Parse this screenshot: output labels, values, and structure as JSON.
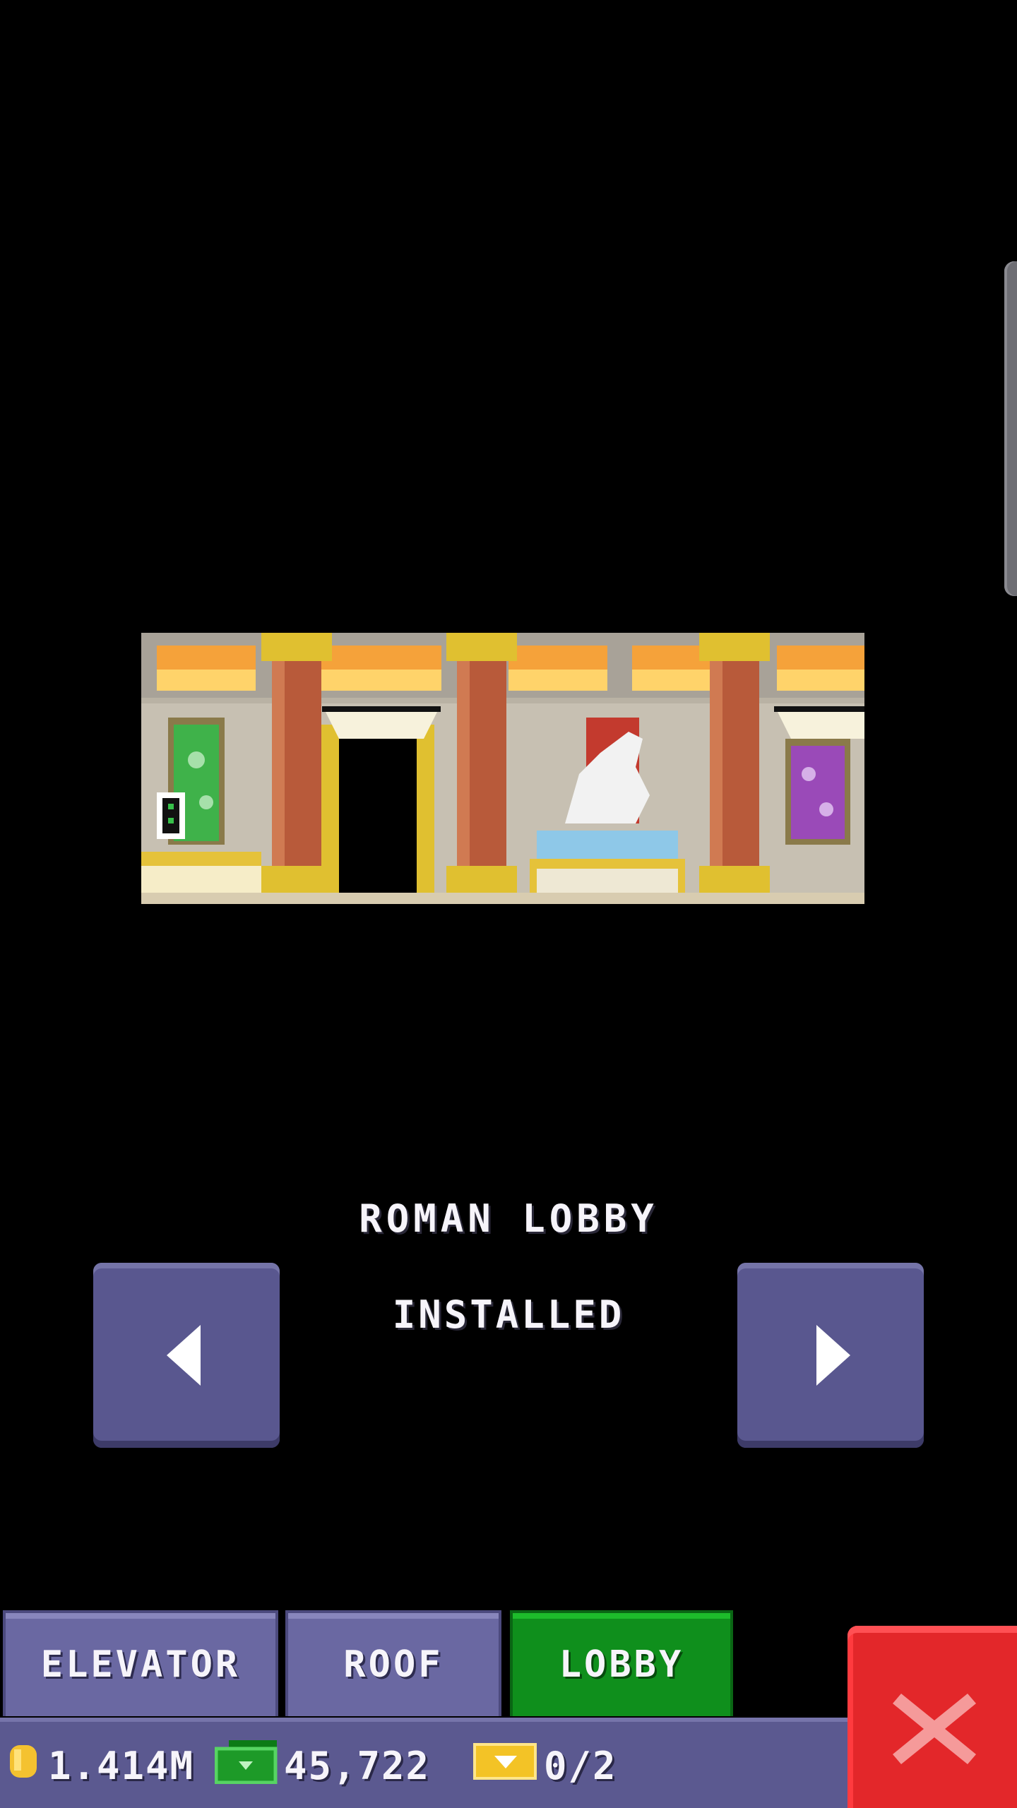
{
  "room": {
    "name": "ROMAN LOBBY",
    "status": "INSTALLED"
  },
  "navigation": {
    "prev_icon": "left-triangle-icon",
    "next_icon": "right-triangle-icon"
  },
  "tabs": [
    {
      "label": "ELEVATOR",
      "active": false
    },
    {
      "label": "ROOF",
      "active": false
    },
    {
      "label": "LOBBY",
      "active": true
    }
  ],
  "currency": {
    "coins": "1.414M",
    "cash": "45,722",
    "tickets": "0/2"
  },
  "colors": {
    "button": "#59578f",
    "tab_active": "#0f8f1c",
    "close": "#e3272a",
    "background": "#000000"
  }
}
